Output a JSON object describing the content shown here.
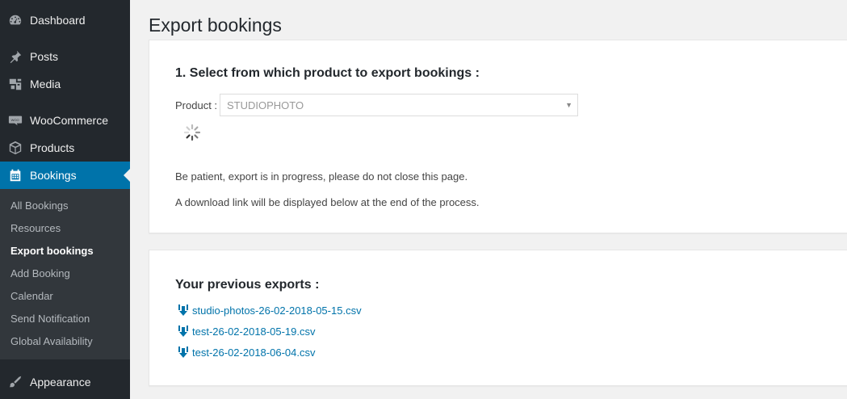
{
  "sidebar": {
    "items": [
      {
        "label": "Dashboard",
        "icon": "dashboard-icon"
      },
      {
        "label": "Posts",
        "icon": "pin-icon"
      },
      {
        "label": "Media",
        "icon": "media-icon"
      },
      {
        "label": "WooCommerce",
        "icon": "woocommerce-icon"
      },
      {
        "label": "Products",
        "icon": "box-icon"
      },
      {
        "label": "Bookings",
        "icon": "calendar-icon"
      },
      {
        "label": "Appearance",
        "icon": "brush-icon"
      }
    ],
    "submenu": [
      {
        "label": "All Bookings"
      },
      {
        "label": "Resources"
      },
      {
        "label": "Export bookings"
      },
      {
        "label": "Add Booking"
      },
      {
        "label": "Calendar"
      },
      {
        "label": "Send Notification"
      },
      {
        "label": "Global Availability"
      }
    ]
  },
  "page": {
    "title": "Export bookings"
  },
  "export_panel": {
    "heading": "1. Select from which product to export bookings :",
    "product_label": "Product :",
    "product_value": "STUDIOPHOTO",
    "notice_1": "Be patient, export is in progress, please do not close this page.",
    "notice_2": "A download link will be displayed below at the end of the process."
  },
  "previous_exports": {
    "heading": "Your previous exports :",
    "files": [
      {
        "name": "studio-photos-26-02-2018-05-15.csv"
      },
      {
        "name": "test-26-02-2018-05-19.csv"
      },
      {
        "name": "test-26-02-2018-06-04.csv"
      }
    ]
  },
  "colors": {
    "sidebar_bg": "#23282d",
    "submenu_bg": "#32373c",
    "accent": "#0073aa",
    "page_bg": "#f1f1f1"
  }
}
